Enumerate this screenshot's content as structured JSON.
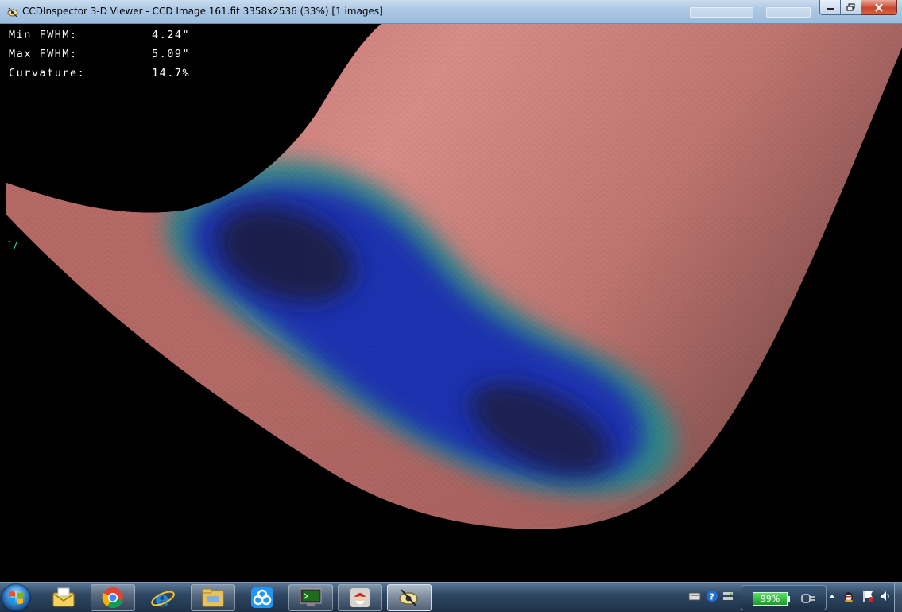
{
  "window": {
    "title": "CCDInspector 3-D Viewer - CCD Image 161.fit 3358x2536 (33%)  [1 images]"
  },
  "stats": [
    {
      "label": "Min FWHM:",
      "value": "4.24\""
    },
    {
      "label": "Max FWHM:",
      "value": "5.09\""
    },
    {
      "label": "Curvature:",
      "value": "14.7%"
    }
  ],
  "axis_mark": "¯7",
  "taskbar": {
    "items": [
      {
        "name": "mail-icon"
      },
      {
        "name": "chrome-icon"
      },
      {
        "name": "internet-explorer-icon"
      },
      {
        "name": "file-explorer-icon"
      },
      {
        "name": "cloud-sync-icon"
      },
      {
        "name": "terminal-monitor-icon"
      },
      {
        "name": "santa-app-icon"
      },
      {
        "name": "ccdinspector-icon"
      }
    ],
    "battery_percent": "99%"
  },
  "colors": {
    "surface_pink": "#c97672",
    "surface_blue": "#1c1f9e",
    "surface_teal": "#2a8a8a",
    "titlebar": "#aac6e3"
  }
}
